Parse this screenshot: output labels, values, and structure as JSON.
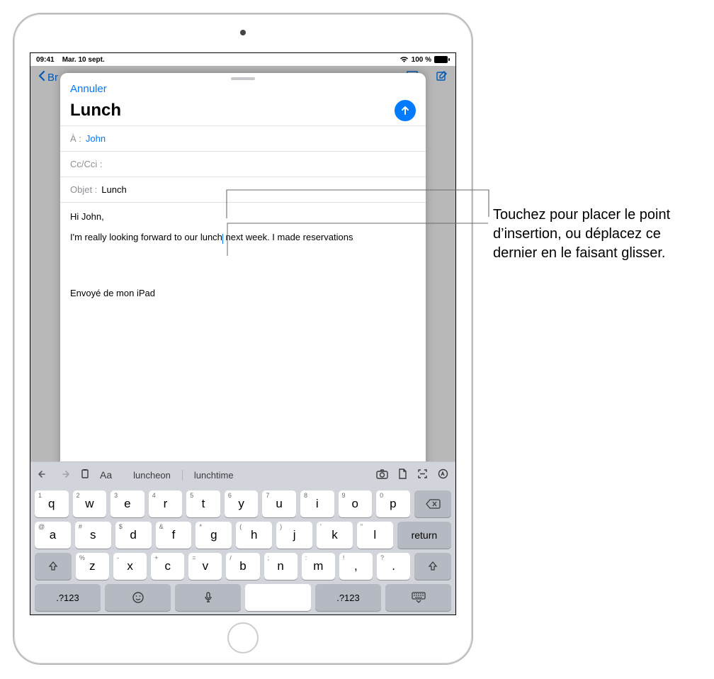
{
  "statusbar": {
    "time": "09:41",
    "date": "Mar. 10 sept.",
    "battery": "100 %"
  },
  "bg_toolbar": {
    "back": "Br"
  },
  "compose": {
    "cancel": "Annuler",
    "title": "Lunch",
    "to_label": "À :",
    "to_value": "John",
    "cc_label": "Cc/Cci :",
    "subject_label": "Objet :",
    "subject_value": "Lunch",
    "body_greeting": "Hi John,",
    "body_line_before": "I'm really looking forward to our lunch",
    "body_line_after": " next week. I made reservations",
    "signature": "Envoyé de mon iPad"
  },
  "keyboard": {
    "suggestions": [
      "luncheon",
      "lunchtime"
    ],
    "row1": [
      {
        "sub": "1",
        "k": "q"
      },
      {
        "sub": "2",
        "k": "w"
      },
      {
        "sub": "3",
        "k": "e"
      },
      {
        "sub": "4",
        "k": "r"
      },
      {
        "sub": "5",
        "k": "t"
      },
      {
        "sub": "6",
        "k": "y"
      },
      {
        "sub": "7",
        "k": "u"
      },
      {
        "sub": "8",
        "k": "i"
      },
      {
        "sub": "9",
        "k": "o"
      },
      {
        "sub": "0",
        "k": "p"
      }
    ],
    "row2": [
      {
        "sub": "@",
        "k": "a"
      },
      {
        "sub": "#",
        "k": "s"
      },
      {
        "sub": "$",
        "k": "d"
      },
      {
        "sub": "&",
        "k": "f"
      },
      {
        "sub": "*",
        "k": "g"
      },
      {
        "sub": "(",
        "k": "h"
      },
      {
        "sub": ")",
        "k": "j"
      },
      {
        "sub": "'",
        "k": "k"
      },
      {
        "sub": "\"",
        "k": "l"
      }
    ],
    "row3": [
      {
        "sub": "%",
        "k": "z"
      },
      {
        "sub": "-",
        "k": "x"
      },
      {
        "sub": "+",
        "k": "c"
      },
      {
        "sub": "=",
        "k": "v"
      },
      {
        "sub": "/",
        "k": "b"
      },
      {
        "sub": ";",
        "k": "n"
      },
      {
        "sub": ":",
        "k": "m"
      },
      {
        "sub": "!",
        "k": ","
      },
      {
        "sub": "?",
        "k": "."
      }
    ],
    "return": "return",
    "numkey": ".?123"
  },
  "callout": {
    "text": "Touchez pour placer le point d’insertion, ou déplacez ce dernier en le faisant glisser."
  }
}
